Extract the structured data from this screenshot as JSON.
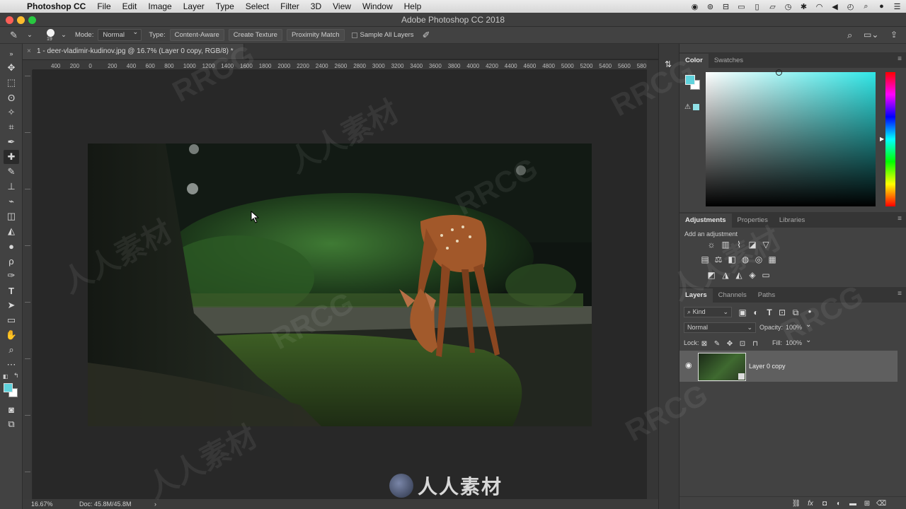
{
  "menubar": {
    "app_name": "Photoshop CC",
    "items": [
      "File",
      "Edit",
      "Image",
      "Layer",
      "Type",
      "Select",
      "Filter",
      "3D",
      "View",
      "Window",
      "Help"
    ]
  },
  "window": {
    "title": "Adobe Photoshop CC 2018"
  },
  "options": {
    "brush_size": "19",
    "mode_label": "Mode:",
    "mode_value": "Normal",
    "type_label": "Type:",
    "type_buttons": [
      "Content-Aware",
      "Create Texture",
      "Proximity Match"
    ],
    "sample_all_layers": "Sample All Layers"
  },
  "document": {
    "tab_title": "1 - deer-vladimir-kudinov.jpg @ 16.7% (Layer 0 copy, RGB/8) *",
    "close_glyph": "×",
    "ruler_ticks": [
      "400",
      "200",
      "0",
      "200",
      "400",
      "600",
      "800",
      "1000",
      "1200",
      "1400",
      "1600",
      "1800",
      "2000",
      "2200",
      "2400",
      "2600",
      "2800",
      "3000",
      "3200",
      "3400",
      "3600",
      "3800",
      "4000",
      "4200",
      "4400",
      "4600",
      "4800",
      "5000",
      "5200",
      "5400",
      "5600",
      "580"
    ],
    "zoom": "16.67%",
    "doc_info": "Doc: 45.8M/45.8M"
  },
  "color_panel": {
    "tabs": [
      "Color",
      "Swatches"
    ],
    "fg_color": "#5fd2dc",
    "bg_color": "#ffffff",
    "hue_color": "#30e6e6"
  },
  "adjustments_panel": {
    "tabs": [
      "Adjustments",
      "Properties",
      "Libraries"
    ],
    "heading": "Add an adjustment"
  },
  "layers_panel": {
    "tabs": [
      "Layers",
      "Channels",
      "Paths"
    ],
    "filter_kind": "Kind",
    "blend_mode": "Normal",
    "opacity_label": "Opacity:",
    "opacity_value": "100%",
    "lock_label": "Lock:",
    "fill_label": "Fill:",
    "fill_value": "100%",
    "layers": [
      {
        "name": "Layer 0 copy",
        "visible": true
      }
    ]
  },
  "watermark_text": [
    "人人素材",
    "RRCG"
  ]
}
